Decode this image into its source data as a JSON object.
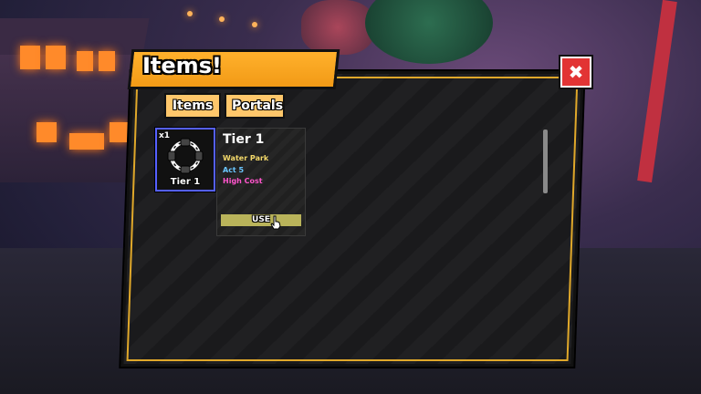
{
  "window": {
    "title": "Items!",
    "close_label": "✖"
  },
  "tabs": [
    {
      "label": "Items"
    },
    {
      "label": "Portals"
    }
  ],
  "inventory": {
    "slots": [
      {
        "count": "x1",
        "label": "Tier 1",
        "icon": "portal-ring-icon"
      }
    ]
  },
  "detail": {
    "title": "Tier 1",
    "map": "Water Park",
    "act": "Act 5",
    "modifier": "High Cost",
    "use_label": "USE"
  },
  "colors": {
    "accent": "#f29a16",
    "panel_border": "#e0a82a",
    "close": "#e23434",
    "map_text": "#f4d96a",
    "act_text": "#6ac6ff",
    "modifier_text": "#ff55cc",
    "slot_border": "#5560ff"
  }
}
